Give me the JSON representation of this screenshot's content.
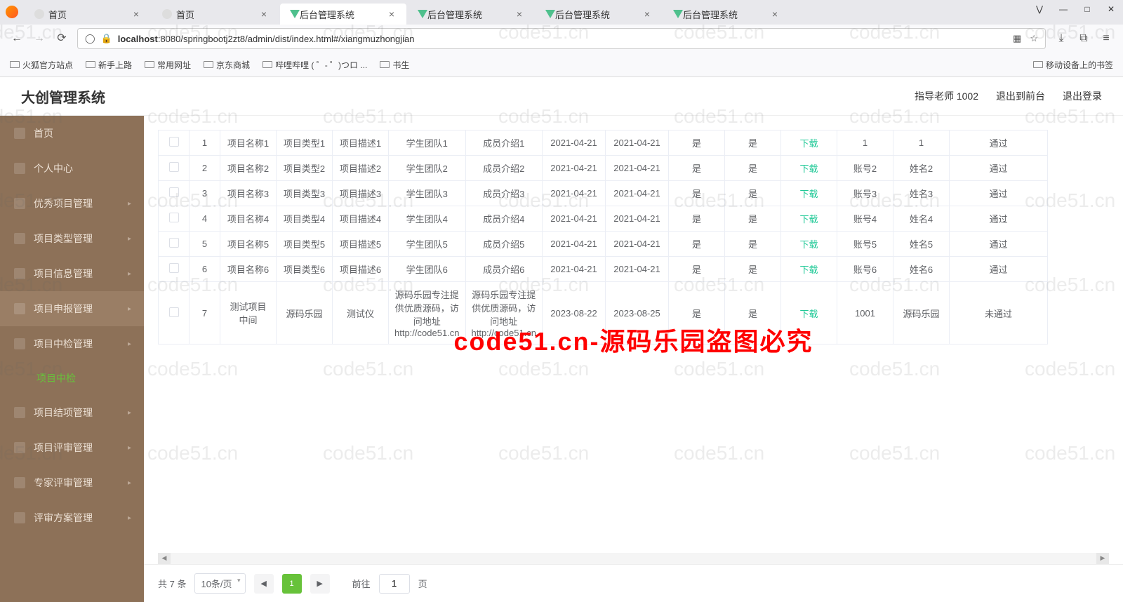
{
  "browser": {
    "tabs": [
      {
        "title": "首页"
      },
      {
        "title": "首页"
      },
      {
        "title": "后台管理系统"
      },
      {
        "title": "后台管理系统"
      },
      {
        "title": "后台管理系统"
      },
      {
        "title": "后台管理系统"
      }
    ],
    "active_tab_index": 2,
    "url_host": "localhost",
    "url_path": ":8080/springbootj2zt8/admin/dist/index.html#/xiangmuzhongjian",
    "bookmarks": [
      "火狐官方站点",
      "新手上路",
      "常用网址",
      "京东商城",
      "哔哩哔哩 ( ゜- ゜)つロ ...",
      "书生"
    ],
    "mobile_bookmarks": "移动设备上的书签"
  },
  "app": {
    "title": "大创管理系统",
    "header_user": "指导老师 1002",
    "header_logout_front": "退出到前台",
    "header_logout": "退出登录"
  },
  "sidebar": {
    "items": [
      {
        "label": "首页"
      },
      {
        "label": "个人中心"
      },
      {
        "label": "优秀项目管理"
      },
      {
        "label": "项目类型管理"
      },
      {
        "label": "项目信息管理"
      },
      {
        "label": "项目申报管理"
      },
      {
        "label": "项目中检管理"
      },
      {
        "label": "项目结项管理"
      },
      {
        "label": "项目评审管理"
      },
      {
        "label": "专家评审管理"
      },
      {
        "label": "评审方案管理"
      }
    ],
    "submenu_label": "项目中检"
  },
  "table": {
    "download_label": "下载",
    "rows": [
      {
        "idx": "1",
        "name": "项目名称1",
        "type": "项目类型1",
        "desc": "项目描述1",
        "team": "学生团队1",
        "members": "成员介绍1",
        "date1": "2021-04-21",
        "date2": "2021-04-21",
        "flag1": "是",
        "flag2": "是",
        "acct": "1",
        "uname": "1",
        "status": "通过"
      },
      {
        "idx": "2",
        "name": "项目名称2",
        "type": "项目类型2",
        "desc": "项目描述2",
        "team": "学生团队2",
        "members": "成员介绍2",
        "date1": "2021-04-21",
        "date2": "2021-04-21",
        "flag1": "是",
        "flag2": "是",
        "acct": "账号2",
        "uname": "姓名2",
        "status": "通过"
      },
      {
        "idx": "3",
        "name": "项目名称3",
        "type": "项目类型3",
        "desc": "项目描述3",
        "team": "学生团队3",
        "members": "成员介绍3",
        "date1": "2021-04-21",
        "date2": "2021-04-21",
        "flag1": "是",
        "flag2": "是",
        "acct": "账号3",
        "uname": "姓名3",
        "status": "通过"
      },
      {
        "idx": "4",
        "name": "项目名称4",
        "type": "项目类型4",
        "desc": "项目描述4",
        "team": "学生团队4",
        "members": "成员介绍4",
        "date1": "2021-04-21",
        "date2": "2021-04-21",
        "flag1": "是",
        "flag2": "是",
        "acct": "账号4",
        "uname": "姓名4",
        "status": "通过"
      },
      {
        "idx": "5",
        "name": "项目名称5",
        "type": "项目类型5",
        "desc": "项目描述5",
        "team": "学生团队5",
        "members": "成员介绍5",
        "date1": "2021-04-21",
        "date2": "2021-04-21",
        "flag1": "是",
        "flag2": "是",
        "acct": "账号5",
        "uname": "姓名5",
        "status": "通过"
      },
      {
        "idx": "6",
        "name": "项目名称6",
        "type": "项目类型6",
        "desc": "项目描述6",
        "team": "学生团队6",
        "members": "成员介绍6",
        "date1": "2021-04-21",
        "date2": "2021-04-21",
        "flag1": "是",
        "flag2": "是",
        "acct": "账号6",
        "uname": "姓名6",
        "status": "通过"
      },
      {
        "idx": "7",
        "name": "测试项目中间",
        "type": "源码乐园",
        "desc": "测试仪",
        "team": "源码乐园专注提供优质源码，访问地址http://code51.cn",
        "members": "源码乐园专注提供优质源码，访问地址http://code51.cn",
        "date1": "2023-08-22",
        "date2": "2023-08-25",
        "flag1": "是",
        "flag2": "是",
        "acct": "1001",
        "uname": "源码乐园",
        "status": "未通过"
      }
    ]
  },
  "pager": {
    "total_text": "共 7 条",
    "page_size": "10条/页",
    "goto_text": "前往",
    "current_page": "1",
    "page_suffix": "页"
  },
  "watermark": {
    "grey": "code51.cn",
    "red": "code51.cn-源码乐园盗图必究"
  }
}
